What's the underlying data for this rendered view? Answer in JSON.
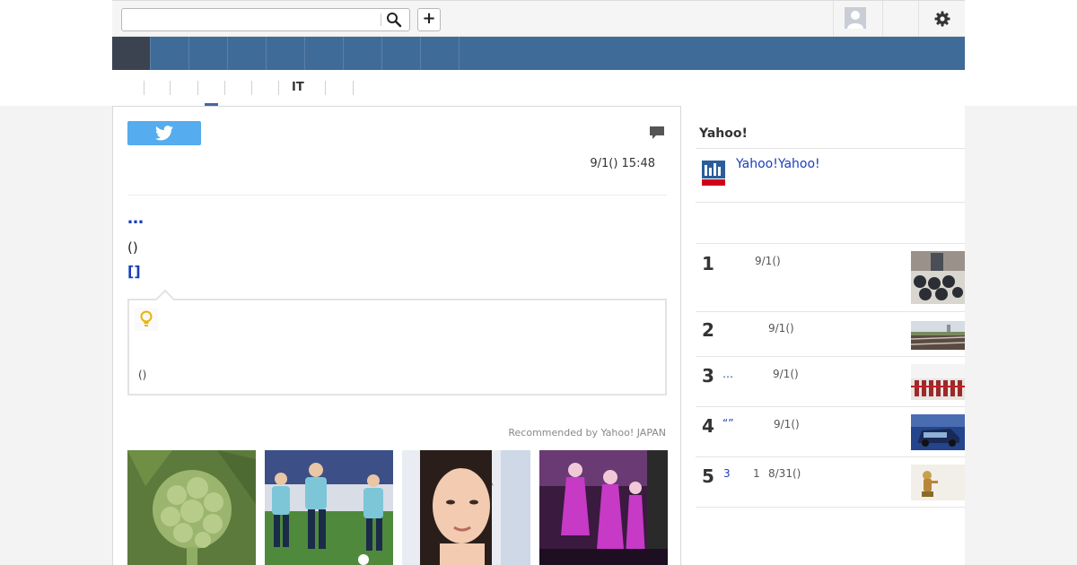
{
  "header": {
    "search": {
      "value": "",
      "placeholder": ""
    },
    "add_label": "+",
    "icons": {
      "search": "search-icon",
      "add": "plus-icon",
      "avatar": "user-avatar-icon",
      "settings": "gear-icon"
    }
  },
  "nav": {
    "items": [
      "",
      "",
      "",
      "",
      "",
      "",
      "",
      "",
      ""
    ],
    "active_index": 0,
    "colors": {
      "bar": "#3f6b98",
      "active": "#3b4350"
    }
  },
  "subnav": {
    "items": [
      "",
      "",
      "",
      "",
      "",
      "IT",
      "",
      ""
    ],
    "active_index": 2
  },
  "article": {
    "share": {
      "twitter_icon": "twitter-bird-icon"
    },
    "comment_icon": "comment-icon",
    "datetime": "9/1() 15:48",
    "source_link": "…",
    "paren_text": "()",
    "bracket_link": "[]",
    "hint": {
      "icon": "lightbulb-icon",
      "note": "()"
    },
    "recommended_label": "Recommended by Yahoo! JAPAN",
    "thumbnails": [
      "broccoli-photo",
      "soccer-players-photo",
      "woman-portrait-photo",
      "party-stage-photo"
    ]
  },
  "sidebar": {
    "heading": "Yahoo!",
    "promo": {
      "icon": "yahoo-app-icon",
      "text": "Yahoo!Yahoo!"
    },
    "ranking": [
      {
        "rank": "1",
        "title": "",
        "date": "9/1()",
        "image": "watches-photo"
      },
      {
        "rank": "2",
        "title": "",
        "date": "9/1()",
        "image": "railway-photo"
      },
      {
        "rank": "3",
        "title": "…",
        "date": "9/1()",
        "image": "ceremony-photo"
      },
      {
        "rank": "4",
        "title": "“”",
        "date": "9/1()",
        "image": "car-photo"
      },
      {
        "rank": "5",
        "title": "3",
        "count": "1",
        "date": "8/31()",
        "image": "figure-photo"
      }
    ]
  },
  "colors": {
    "link": "#1a3eb8",
    "twitter": "#55acee",
    "page_bg": "#f3f3f3"
  }
}
